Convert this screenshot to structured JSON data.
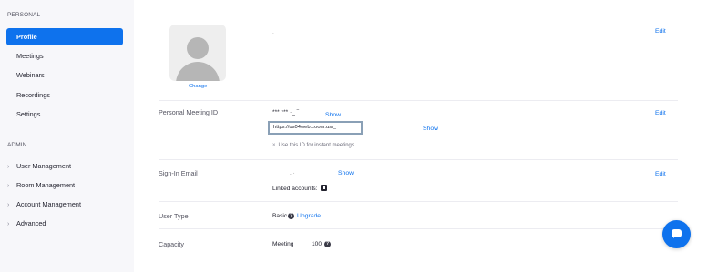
{
  "sidebar": {
    "personal_header": "PERSONAL",
    "personal_items": [
      {
        "label": "Profile"
      },
      {
        "label": "Meetings"
      },
      {
        "label": "Webinars"
      },
      {
        "label": "Recordings"
      },
      {
        "label": "Settings"
      }
    ],
    "admin_header": "ADMIN",
    "admin_items": [
      {
        "label": "User Management"
      },
      {
        "label": "Room Management"
      },
      {
        "label": "Account Management"
      },
      {
        "label": "Advanced"
      }
    ],
    "active_color": "#0e72ed"
  },
  "profile": {
    "name_value": ".",
    "change_label": "Change",
    "edit_label": "Edit"
  },
  "pmi": {
    "label": "Personal Meeting ID",
    "masked_value": "*** *** ·_ ‾",
    "show_label": "Show",
    "url_value": "https://us04web.zoom.us/_",
    "url_show_label": "Show",
    "instant_note": "Use this ID for instant meetings",
    "edit_label": "Edit"
  },
  "signin": {
    "label": "Sign-In Email",
    "masked_value": ".            ·",
    "show_label": "Show",
    "linked_label": "Linked accounts:",
    "edit_label": "Edit"
  },
  "user_type": {
    "label": "User Type",
    "value": "Basic",
    "upgrade_label": "Upgrade"
  },
  "capacity": {
    "label": "Capacity",
    "meeting_label": "Meeting",
    "meeting_value": "100"
  },
  "icons": {
    "help": "question-mark-circle",
    "chat": "chat-bubble",
    "linked": "linked-account-square"
  }
}
